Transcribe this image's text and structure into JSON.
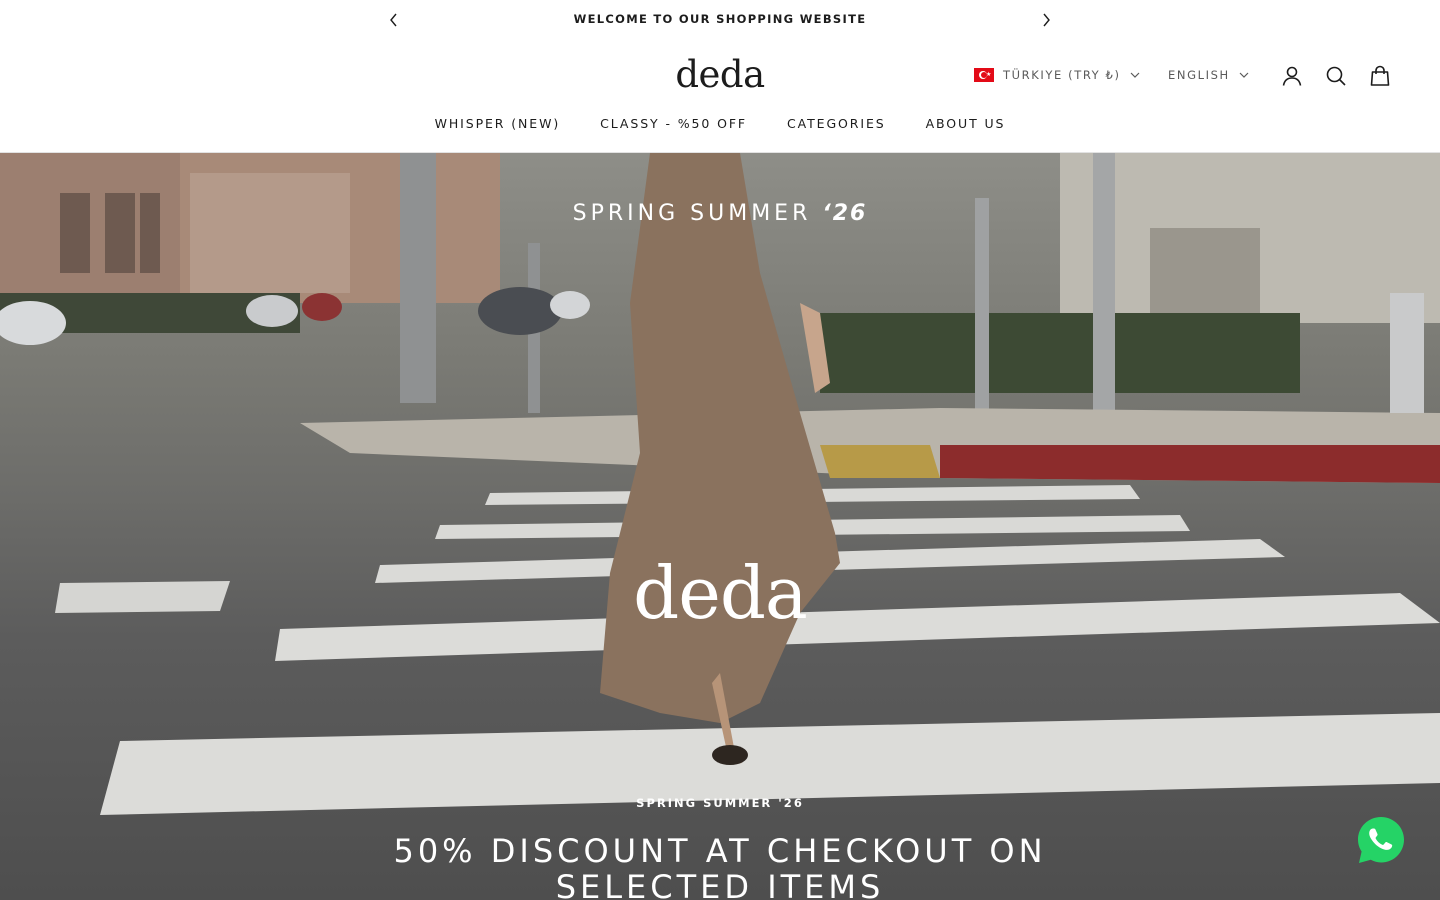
{
  "announcement": {
    "message": "WELCOME TO OUR SHOPPING WEBSITE"
  },
  "header": {
    "logo": "deda",
    "country_selector": "TÜRKIYE (TRY ₺)",
    "language_selector": "ENGLISH",
    "icons": [
      "account-icon",
      "search-icon",
      "cart-icon"
    ]
  },
  "nav": {
    "items": [
      {
        "label": "WHISPER (NEW)"
      },
      {
        "label": "CLASSY - %50 OFF"
      },
      {
        "label": "CATEGORIES"
      },
      {
        "label": "ABOUT US"
      }
    ]
  },
  "hero": {
    "season_text": "SPRING SUMMER",
    "season_year": "‘26",
    "brand": "deda",
    "subheading": "SPRING SUMMER '26",
    "headline_line1": "50% DISCOUNT AT CHECKOUT ON",
    "headline_line2": "SELECTED ITEMS"
  },
  "colors": {
    "text": "#1c1c1c",
    "whatsapp": "#25d366",
    "flag_red": "#e30a17"
  }
}
